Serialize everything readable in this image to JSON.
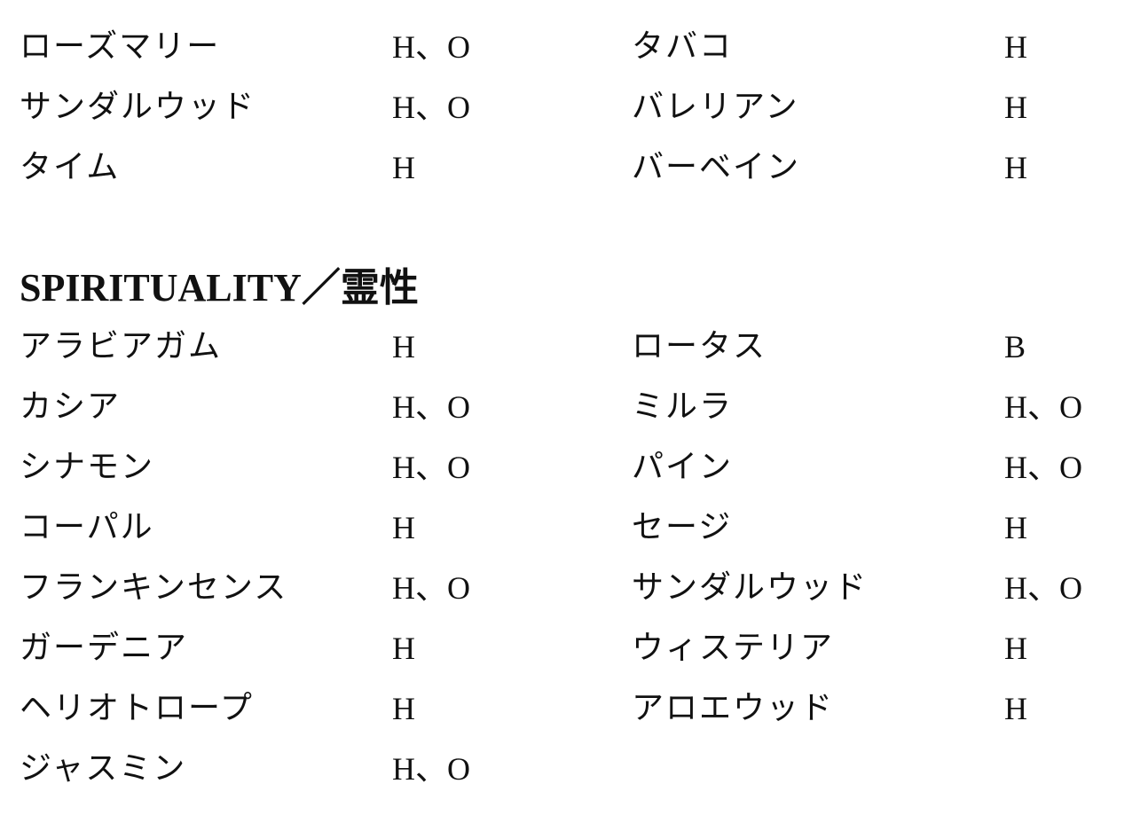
{
  "top_table": {
    "rows": [
      {
        "left_name": "ローズマリー",
        "left_code": "H、O",
        "right_name": "タバコ",
        "right_code": "H"
      },
      {
        "left_name": "サンダルウッド",
        "left_code": "H、O",
        "right_name": "バレリアン",
        "right_code": "H"
      },
      {
        "left_name": "タイム",
        "left_code": "H",
        "right_name": "バーベイン",
        "right_code": "H"
      }
    ]
  },
  "section": {
    "heading": "SPIRITUALITY／霊性"
  },
  "spirit_table": {
    "rows": [
      {
        "left_name": "アラビアガム",
        "left_code": "H",
        "right_name": "ロータス",
        "right_code": "B"
      },
      {
        "left_name": "カシア",
        "left_code": "H、O",
        "right_name": "ミルラ",
        "right_code": "H、O"
      },
      {
        "left_name": "シナモン",
        "left_code": "H、O",
        "right_name": "パイン",
        "right_code": "H、O"
      },
      {
        "left_name": "コーパル",
        "left_code": "H",
        "right_name": "セージ",
        "right_code": "H"
      },
      {
        "left_name": "フランキンセンス",
        "left_code": "H、O",
        "right_name": "サンダルウッド",
        "right_code": "H、O"
      },
      {
        "left_name": "ガーデニア",
        "left_code": "H",
        "right_name": "ウィステリア",
        "right_code": "H"
      },
      {
        "left_name": "ヘリオトロープ",
        "left_code": "H",
        "right_name": "アロエウッド",
        "right_code": "H"
      },
      {
        "left_name": "ジャスミン",
        "left_code": "H、O",
        "right_name": "",
        "right_code": ""
      }
    ]
  }
}
